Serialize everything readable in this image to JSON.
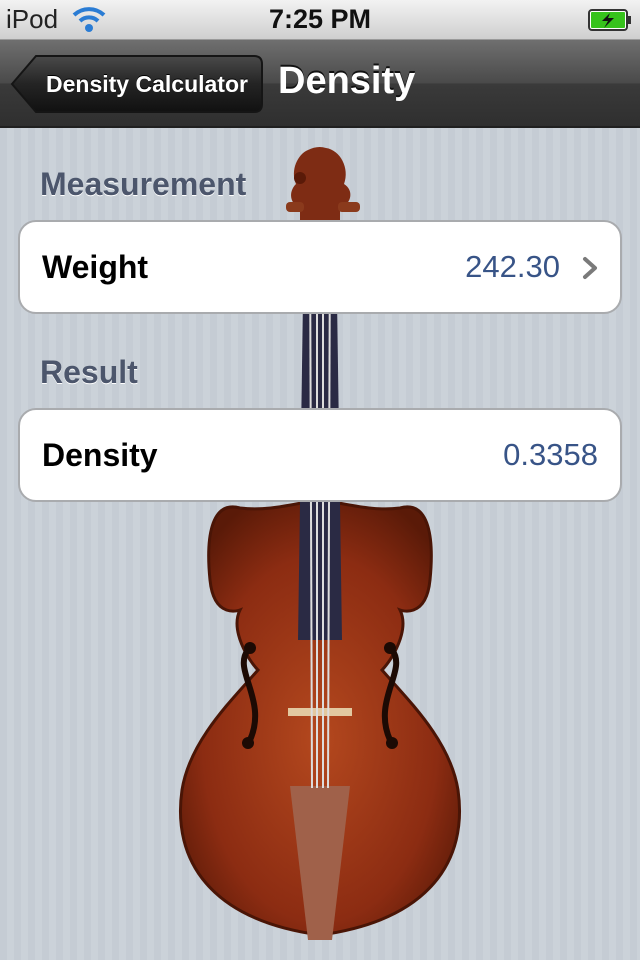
{
  "status_bar": {
    "carrier": "iPod",
    "time": "7:25 PM",
    "wifi_icon": "wifi-icon",
    "battery_icon": "battery-charging-icon",
    "battery_color": "#36c21c"
  },
  "nav_bar": {
    "back_label": "Density Calculator",
    "title": "Density"
  },
  "sections": {
    "measurement": {
      "header": "Measurement",
      "row": {
        "label": "Weight",
        "value": "242.30",
        "accessory_icon": "chevron-right-icon"
      }
    },
    "result": {
      "header": "Result",
      "row": {
        "label": "Density",
        "value": "0.3358"
      }
    }
  },
  "background_image": "violin",
  "colors": {
    "value_text": "#385487",
    "section_header": "#4c566c",
    "background_stripes": "#c5ccd4"
  }
}
